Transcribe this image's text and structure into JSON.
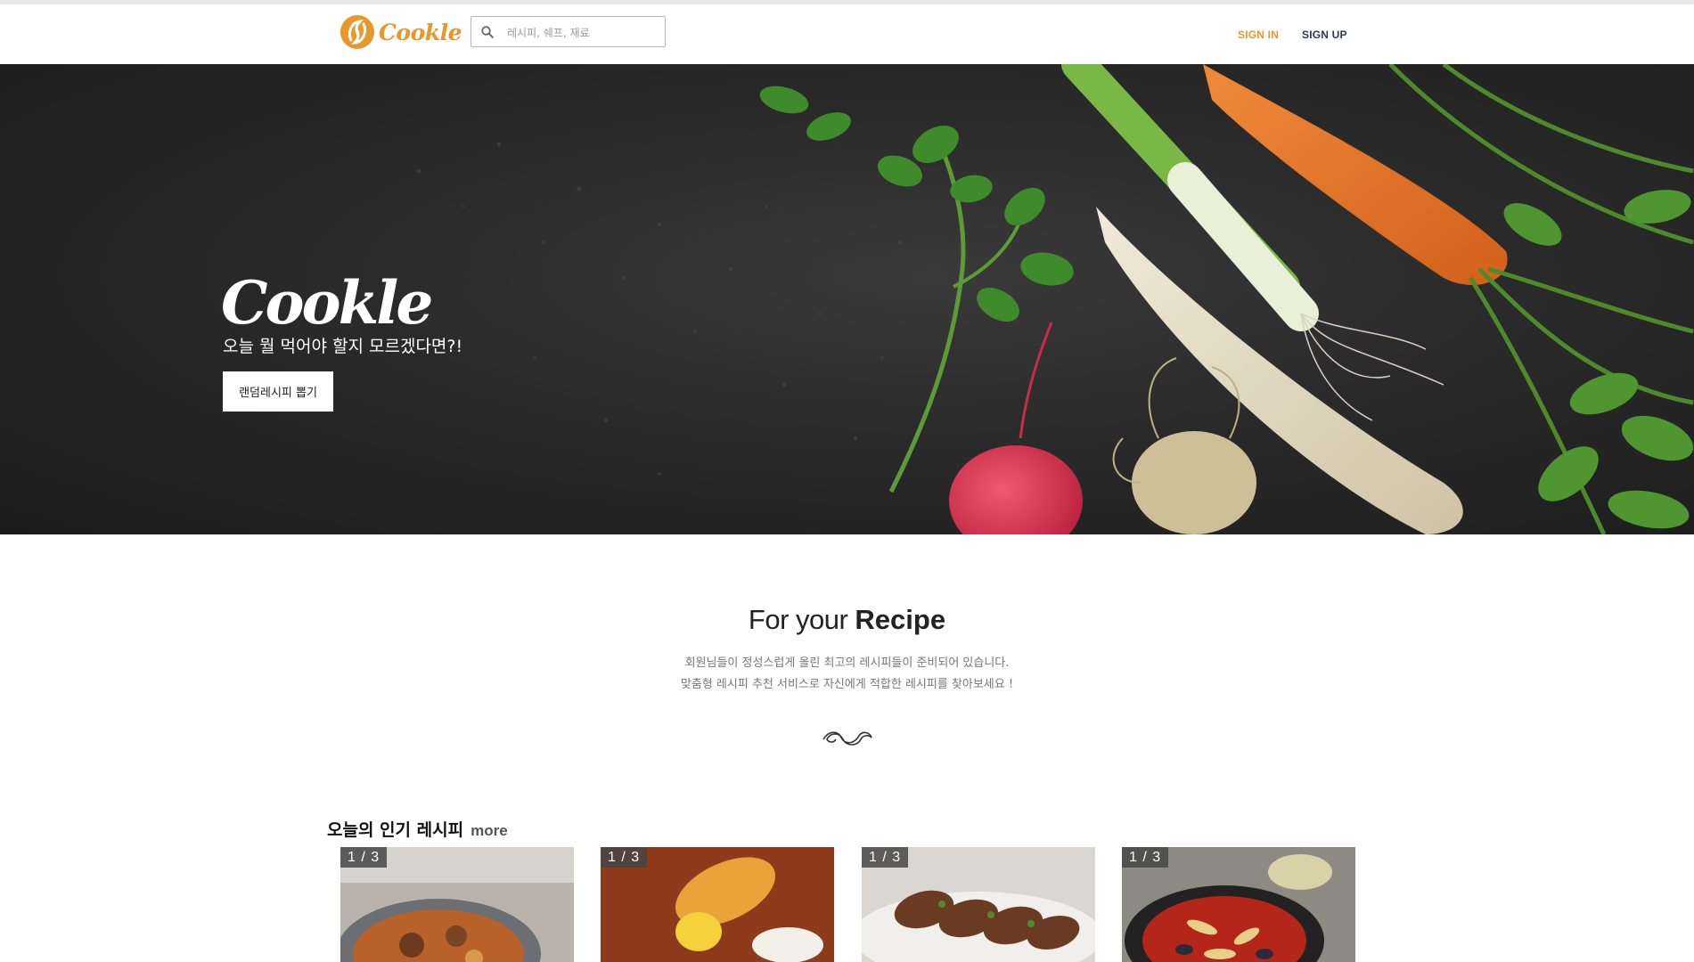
{
  "header": {
    "brand": "Cookle",
    "search_placeholder": "레시피, 쉐프, 재료",
    "sign_in": "SIGN IN",
    "sign_up": "SIGN UP"
  },
  "hero": {
    "brand": "Cookle",
    "subtitle": "오늘 뭘 먹어야 할지 모르겠다면?!",
    "button_label": "랜덤레시피 뽑기"
  },
  "intro": {
    "title_light": "For your ",
    "title_bold": "Recipe",
    "line1": "회원님들이 정성스럽게 올린 최고의 레시피들이 준비되어 있습니다.",
    "line2": "맞춤형 레시피 추천 서비스로 자신에게 적합한 레시피를 찾아보세요 !"
  },
  "popular": {
    "title": "오늘의 인기 레시피",
    "more": "more",
    "cards": [
      {
        "counter": "1 / 3"
      },
      {
        "counter": "1 / 3"
      },
      {
        "counter": "1 / 3"
      },
      {
        "counter": "1 / 3"
      }
    ]
  },
  "colors": {
    "accent": "#e8972a",
    "nav_dark": "#2d3a4d",
    "hero_bg": "#2a2a2a"
  },
  "icons": [
    "logo-mark-icon",
    "search-icon",
    "flourish-icon"
  ]
}
